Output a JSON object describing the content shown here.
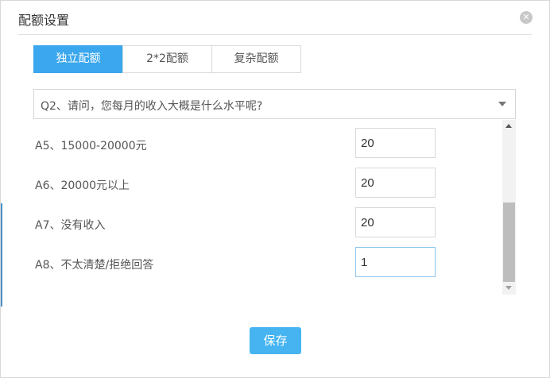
{
  "dialog": {
    "title": "配额设置",
    "close_glyph": "✕"
  },
  "tabs": [
    {
      "label": "独立配额",
      "active": true
    },
    {
      "label": "2*2配额",
      "active": false
    },
    {
      "label": "复杂配额",
      "active": false
    }
  ],
  "question_select": {
    "value": "Q2、请问，您每月的收入大概是什么水平呢?"
  },
  "quota_rows": [
    {
      "label": "A5、15000-20000元",
      "value": "20"
    },
    {
      "label": "A6、20000元以上",
      "value": "20"
    },
    {
      "label": "A7、没有收入",
      "value": "20"
    },
    {
      "label": "A8、不太清楚/拒绝回答",
      "value": "1"
    }
  ],
  "footer": {
    "save_label": "保存"
  },
  "colors": {
    "accent": "#3aa7ee",
    "save_button": "#45b4f1",
    "focus_border": "#8ec7ef"
  }
}
